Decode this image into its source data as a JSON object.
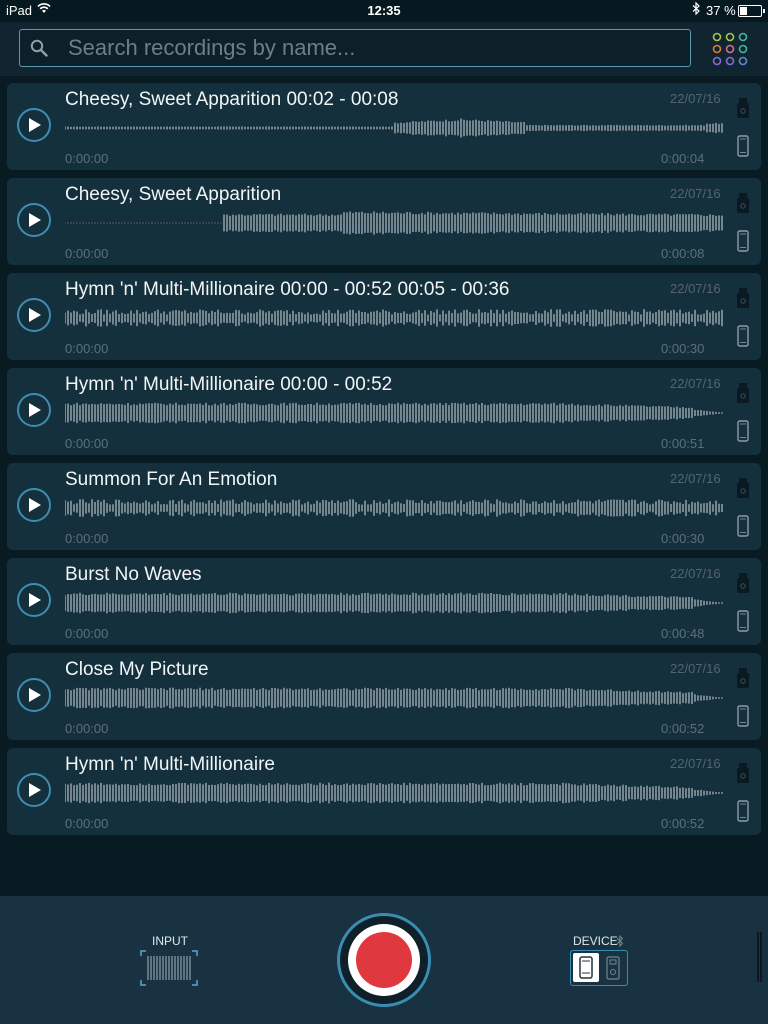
{
  "status_bar": {
    "carrier": "iPad",
    "time": "12:35",
    "battery_percent": "37 %",
    "battery_level": 0.37
  },
  "search": {
    "placeholder": "Search recordings by name...",
    "value": ""
  },
  "colors": {
    "accent": "#3e8db0",
    "record": "#e0383f",
    "card_bg": "#15303d",
    "wave": "#8d9da5"
  },
  "recordings": [
    {
      "title": "Cheesy, Sweet Apparition 00:02 - 00:08",
      "date": "22/07/16",
      "start": "0:00:00",
      "end": "0:00:04",
      "wave": "quiet-mid-burst"
    },
    {
      "title": "Cheesy, Sweet Apparition",
      "date": "22/07/16",
      "start": "0:00:00",
      "end": "0:00:08",
      "wave": "late-start"
    },
    {
      "title": "Hymn 'n' Multi-Millionaire 00:00 - 00:52 00:05 - 00:36",
      "date": "22/07/16",
      "start": "0:00:00",
      "end": "0:00:30",
      "wave": "dense-varying"
    },
    {
      "title": "Hymn 'n' Multi-Millionaire 00:00 - 00:52",
      "date": "22/07/16",
      "start": "0:00:00",
      "end": "0:00:51",
      "wave": "full-fade"
    },
    {
      "title": "Summon For An Emotion",
      "date": "22/07/16",
      "start": "0:00:00",
      "end": "0:00:30",
      "wave": "dense-varying"
    },
    {
      "title": "Burst No Waves",
      "date": "22/07/16",
      "start": "0:00:00",
      "end": "0:00:48",
      "wave": "full-fade"
    },
    {
      "title": "Close My Picture",
      "date": "22/07/16",
      "start": "0:00:00",
      "end": "0:00:52",
      "wave": "full-fade"
    },
    {
      "title": "Hymn 'n' Multi-Millionaire",
      "date": "22/07/16",
      "start": "0:00:00",
      "end": "0:00:52",
      "wave": "full-fade"
    }
  ],
  "icons": {
    "play": "play-icon",
    "external_storage": "usb-drive-icon",
    "device_storage": "phone-icon",
    "grid": "color-grid-icon",
    "search": "search-icon",
    "bluetooth": "bluetooth-icon"
  },
  "bottom_bar": {
    "input_label": "INPUT",
    "device_label": "DEVICE"
  }
}
